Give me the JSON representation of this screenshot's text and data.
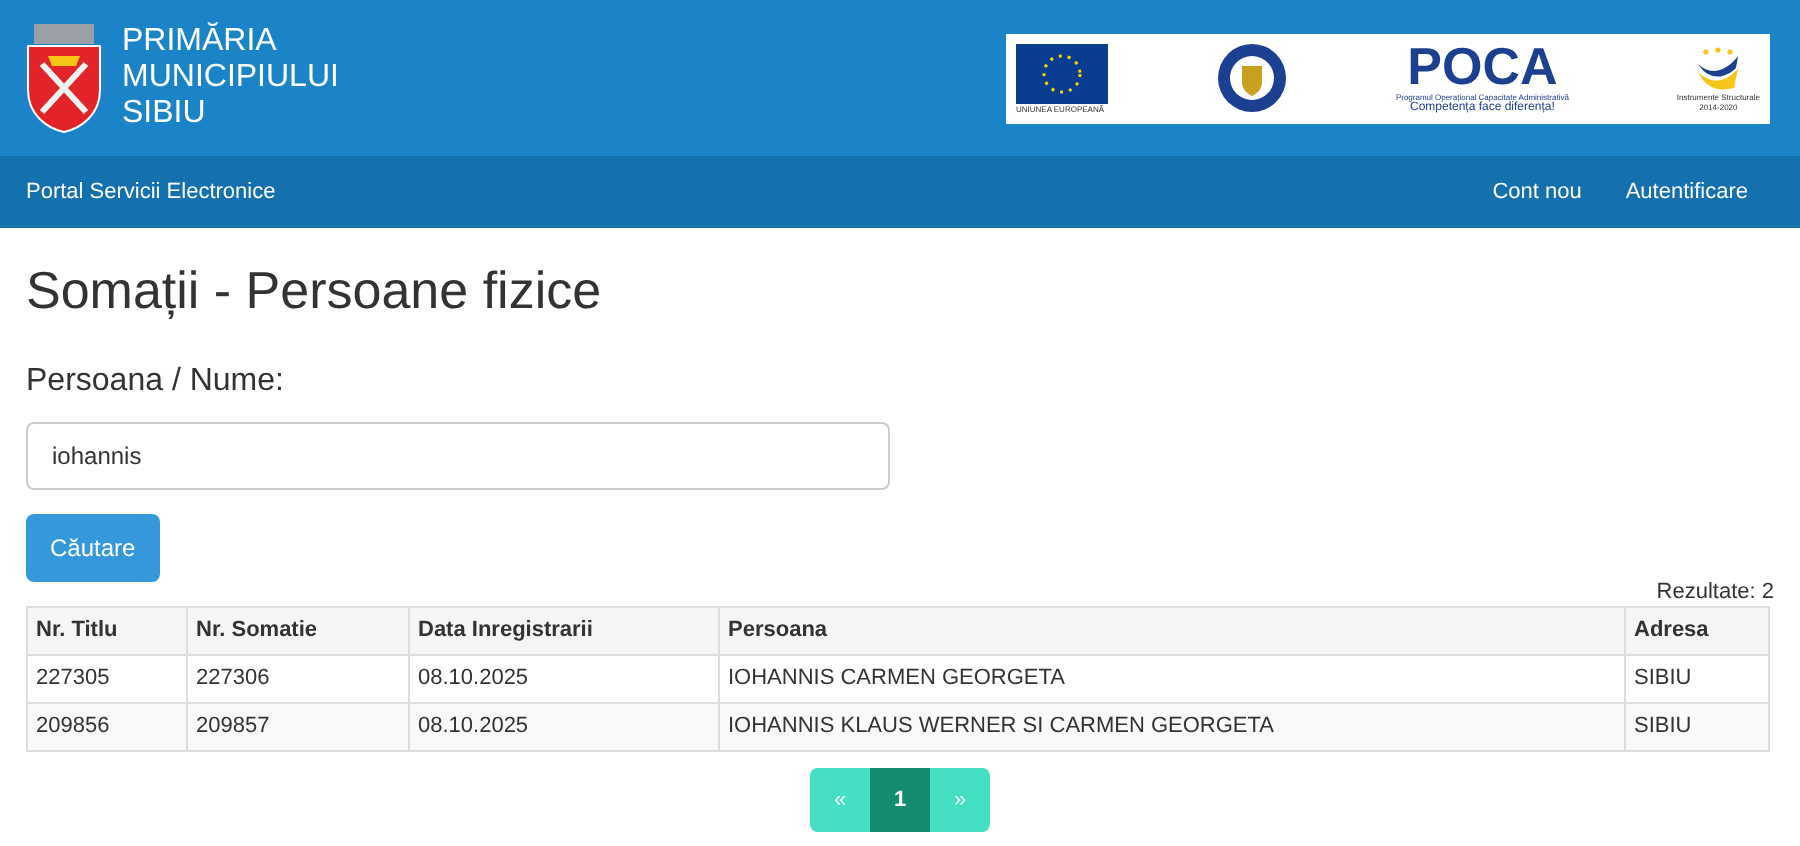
{
  "header": {
    "title_lines": [
      "PRIMĂRIA",
      "MUNICIPIULUI",
      "SIBIU"
    ],
    "logos": {
      "eu": "UNIUNEA EUROPEANĂ",
      "poca": "POCA",
      "poca_sub": "Programul Operațional Capacitate Administrativă",
      "poca_motto": "Competența face diferența!",
      "is": "Instrumente Structurale",
      "is_years": "2014-2020"
    }
  },
  "navbar": {
    "brand": "Portal Servicii Electronice",
    "links": [
      "Cont nou",
      "Autentificare"
    ]
  },
  "page_title": "Somații - Persoane fizice",
  "search": {
    "label": "Persoana / Nume:",
    "value": "iohannis",
    "button": "Căutare"
  },
  "results_count": "Rezultate: 2",
  "table": {
    "columns": [
      "Nr. Titlu",
      "Nr. Somatie",
      "Data Inregistrarii",
      "Persoana",
      "Adresa"
    ],
    "rows": [
      [
        "227305",
        "227306",
        "08.10.2025",
        "IOHANNIS CARMEN GEORGETA",
        "SIBIU"
      ],
      [
        "209856",
        "209857",
        "08.10.2025",
        "IOHANNIS KLAUS WERNER SI CARMEN GEORGETA",
        "SIBIU"
      ]
    ]
  },
  "pagination": [
    {
      "label": "«",
      "selected": false
    },
    {
      "label": "1",
      "selected": true
    },
    {
      "label": "»",
      "selected": false
    }
  ]
}
